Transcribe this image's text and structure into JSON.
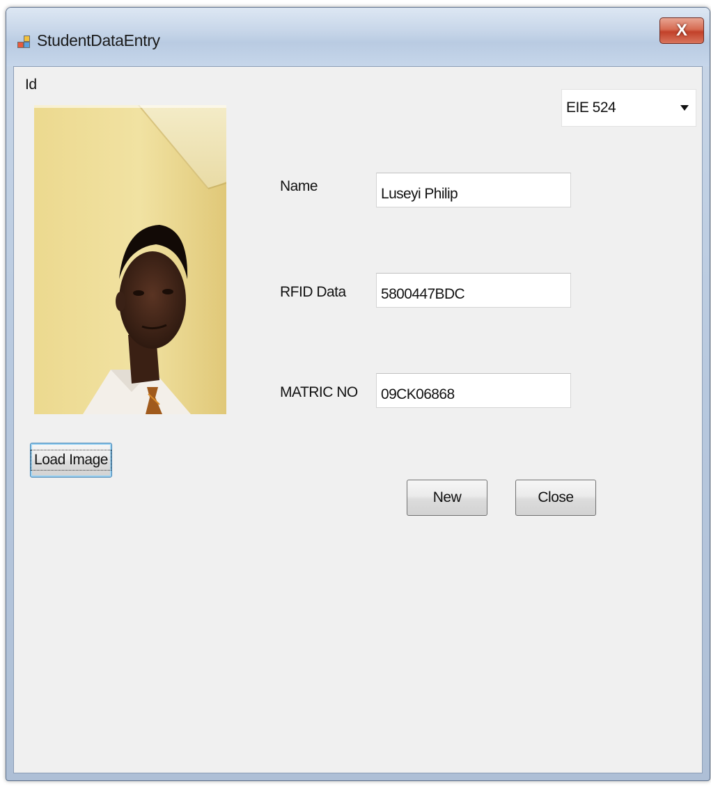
{
  "window": {
    "title": "StudentDataEntry",
    "close_glyph": "X",
    "icon": "app-window-icon"
  },
  "form": {
    "id_label": "Id",
    "course_select": {
      "selected": "EIE 524"
    },
    "name": {
      "label": "Name",
      "value": "Luseyi Philip"
    },
    "rfid": {
      "label": "RFID Data",
      "value": "5800447BDC"
    },
    "matric": {
      "label": "MATRIC NO",
      "value": "09CK06868"
    },
    "load_image_label": "Load Image",
    "new_label": "New",
    "close_label": "Close"
  },
  "colors": {
    "client_bg": "#f0f0f0",
    "title_close_red": "#c2412a",
    "focus_border": "#3c7fb1"
  }
}
